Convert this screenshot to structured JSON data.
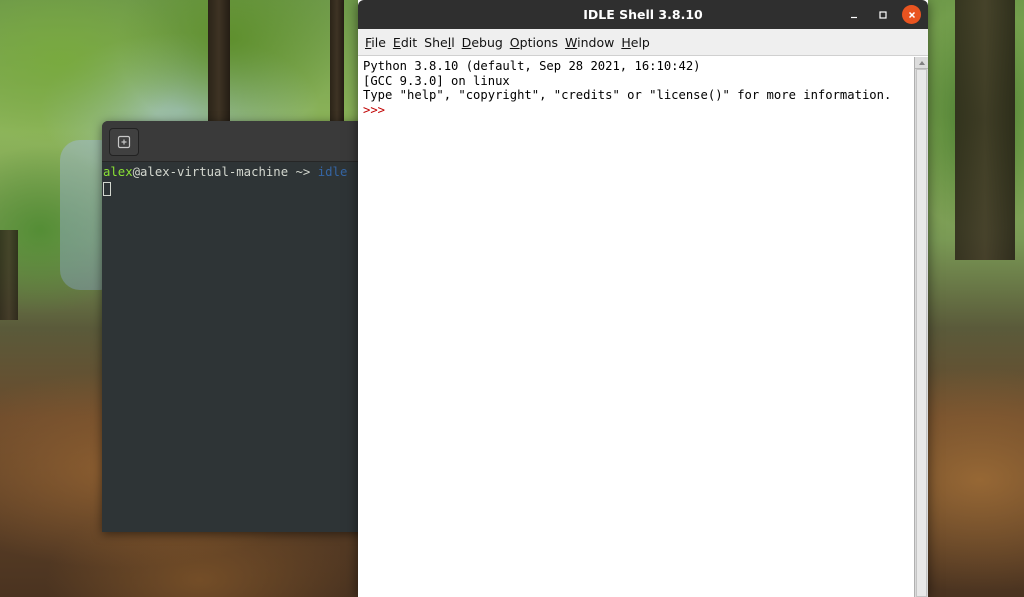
{
  "desktop": {
    "wallpaper": "forest-floor"
  },
  "terminal": {
    "new_tab_icon": "new-tab-icon",
    "prompt_user": "alex",
    "prompt_host": "@alex-virtual-machine",
    "prompt_arrow": " ~> ",
    "command": "idle"
  },
  "idle": {
    "title": "IDLE Shell 3.8.10",
    "window_buttons": {
      "minimize_icon": "minimize-icon",
      "maximize_icon": "maximize-icon",
      "close_icon": "close-icon",
      "close_color": "#e95420"
    },
    "menu": [
      {
        "label": "File",
        "underline": "F",
        "rest": "ile"
      },
      {
        "label": "Edit",
        "underline": "E",
        "rest": "dit"
      },
      {
        "label": "Shell",
        "pre": "She",
        "underline": "l",
        "rest": "l"
      },
      {
        "label": "Debug",
        "underline": "D",
        "rest": "ebug"
      },
      {
        "label": "Options",
        "underline": "O",
        "rest": "ptions"
      },
      {
        "label": "Window",
        "underline": "W",
        "rest": "indow"
      },
      {
        "label": "Help",
        "underline": "H",
        "rest": "elp"
      }
    ],
    "shell_lines": [
      "Python 3.8.10 (default, Sep 28 2021, 16:10:42)",
      "[GCC 9.3.0] on linux",
      "Type \"help\", \"copyright\", \"credits\" or \"license()\" for more information."
    ],
    "prompt": ">>> ",
    "prompt_color": "#c00000"
  }
}
